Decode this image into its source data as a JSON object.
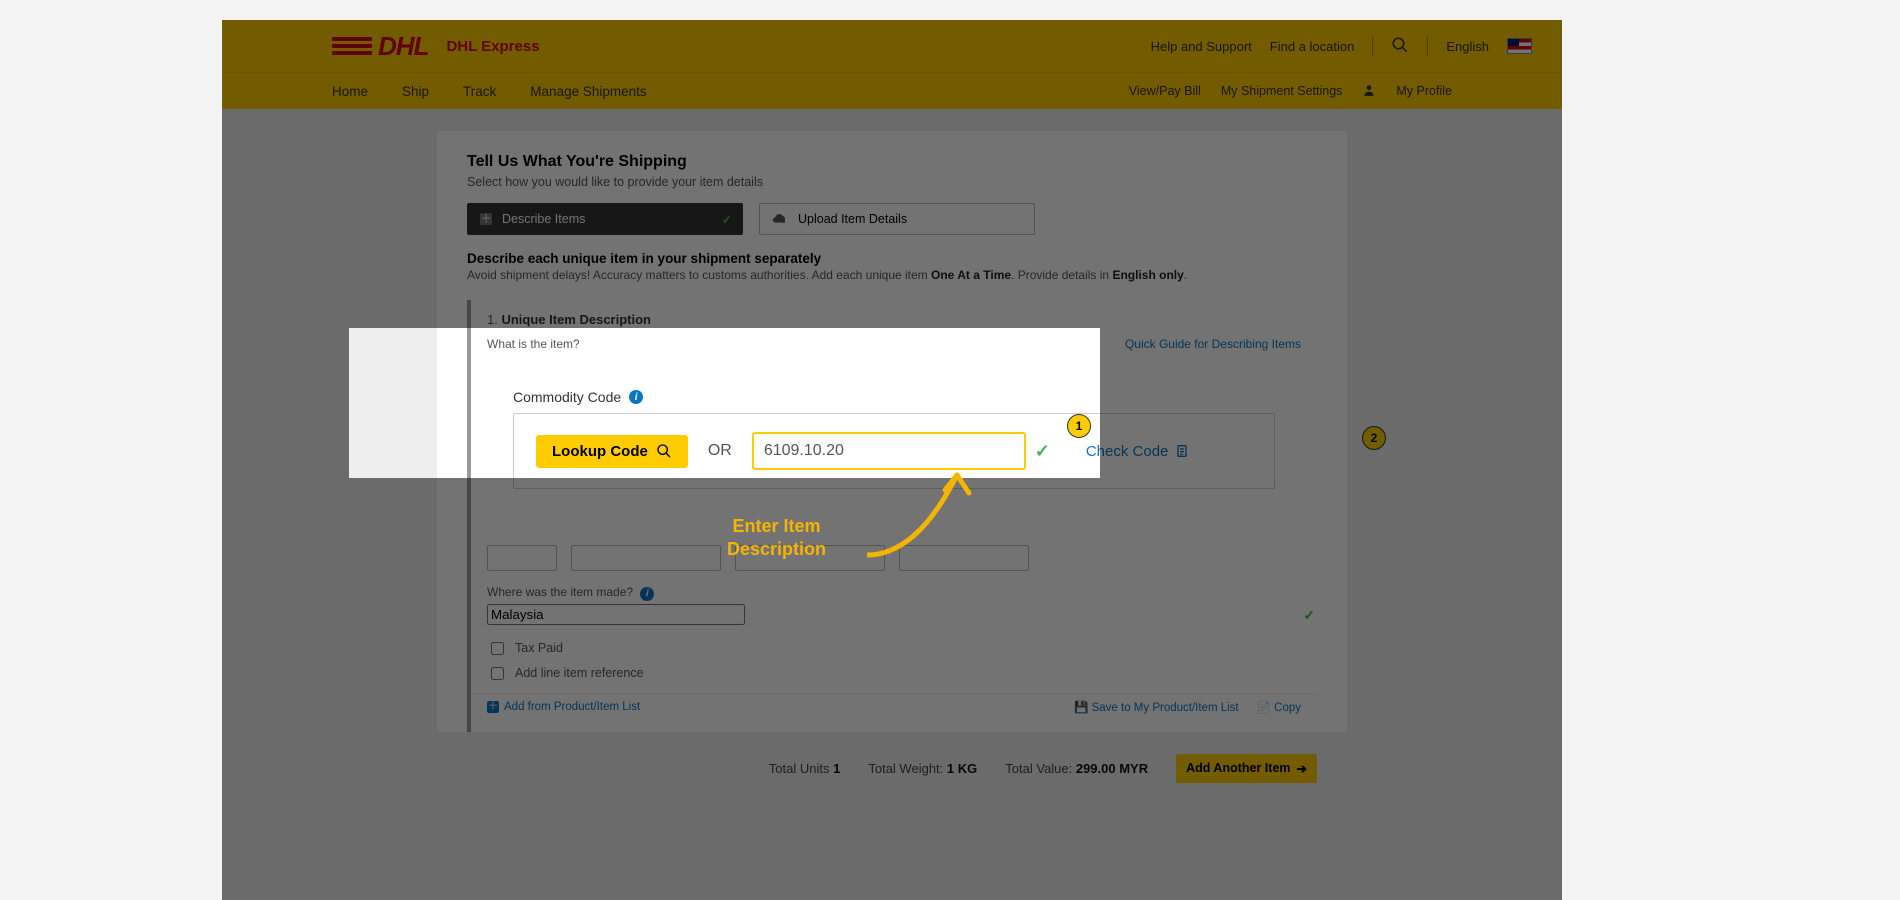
{
  "brand_sub": "DHL Express",
  "top_links": {
    "help": "Help and Support",
    "find": "Find a location",
    "lang": "English"
  },
  "nav": {
    "items": [
      "Home",
      "Ship",
      "Track",
      "Manage Shipments"
    ],
    "right": {
      "pay": "View/Pay Bill",
      "settings": "My Shipment Settings",
      "profile": "My Profile"
    }
  },
  "heading": "Tell Us What You're Shipping",
  "subheading": "Select how you would like to provide your item details",
  "tabs": {
    "describe": "Describe Items",
    "upload": "Upload Item Details"
  },
  "instr_title": "Describe each unique item in your shipment separately",
  "instr_text_a": "Avoid shipment delays! Accuracy matters to customs authorities.  Add each unique item ",
  "instr_b1": "One At a Time",
  "instr_text_b": ".  Provide details in ",
  "instr_b2": "English only",
  "instr_text_c": ".",
  "sec_num": "1.",
  "sec_title": "Unique Item Description",
  "what_label": "What is the item?",
  "guide_link": "Quick Guide for Describing Items",
  "cc": {
    "label": "Commodity Code",
    "lookup": "Lookup Code",
    "or": "OR",
    "value": "6109.10.20",
    "check": "Check Code"
  },
  "badges": {
    "b1": "1",
    "b2": "2"
  },
  "origin_label": "Where was the item made?",
  "origin_value": "Malaysia",
  "checks": {
    "tax": "Tax Paid",
    "ref": "Add line item reference"
  },
  "sec_foot": {
    "add": "Add from Product/Item List",
    "save": "Save to My Product/Item List",
    "copy": "Copy"
  },
  "totals": {
    "u_lab": "Total Units",
    "u_val": "1",
    "w_lab": "Total Weight:",
    "w_val": "1 KG",
    "v_lab": "Total Value:",
    "v_val": "299.00 MYR",
    "btn": "Add Another Item"
  },
  "anno_l1": "Enter Item",
  "anno_l2": "Description"
}
